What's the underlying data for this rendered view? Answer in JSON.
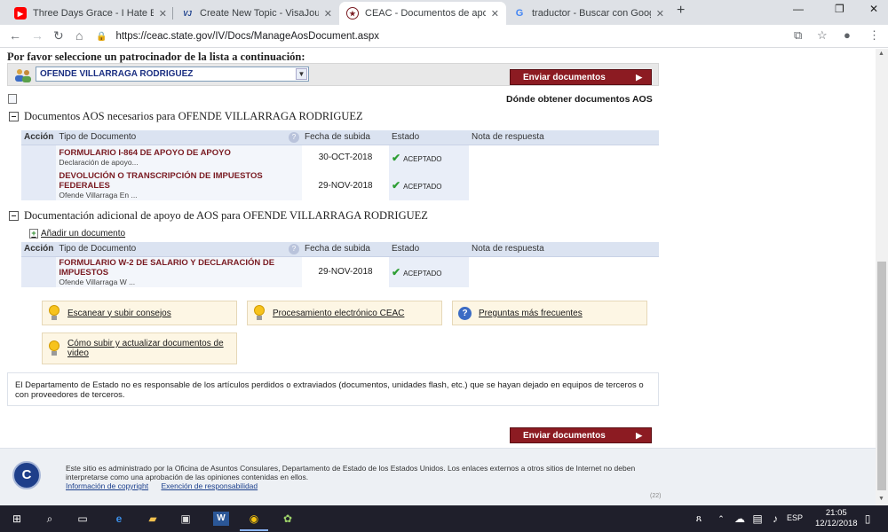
{
  "browser": {
    "tabs": [
      {
        "title": "Three Days Grace - I Hate Everyt",
        "icon": "youtube-icon"
      },
      {
        "title": "Create New Topic - VisaJourney",
        "icon": "visajourney-icon"
      },
      {
        "title": "CEAC - Documentos de apoyo",
        "icon": "state-seal-icon"
      },
      {
        "title": "traductor - Buscar con Google",
        "icon": "google-icon"
      }
    ],
    "url": "https://ceac.state.gov/IV/Docs/ManageAosDocument.aspx"
  },
  "sponsor": {
    "prompt": "Por favor seleccione un patrocinador de la lista a continuación:",
    "selected": "OFENDE VILLARRAGA RODRIGUEZ",
    "send_button": "Enviar documentos"
  },
  "where_link": "Dónde obtener documentos AOS",
  "section1": {
    "title": "Documentos AOS necesarios para OFENDE VILLARRAGA RODRIGUEZ",
    "columns": [
      "Acción",
      "Tipo de Documento",
      "",
      "Fecha de subida",
      "Estado",
      "Nota de respuesta"
    ],
    "rows": [
      {
        "type": "FORMULARIO I-864 DE APOYO DE APOYO",
        "sub": "Declaración de apoyo...",
        "date": "30-OCT-2018",
        "status": "ACEPTADO"
      },
      {
        "type": "DEVOLUCIÓN O TRANSCRIPCIÓN DE IMPUESTOS FEDERALES",
        "sub": "Ofende Villarraga En ...",
        "date": "29-NOV-2018",
        "status": "ACEPTADO"
      }
    ]
  },
  "section2": {
    "title": "Documentación adicional de apoyo de AOS para OFENDE VILLARRAGA RODRIGUEZ",
    "add_link": "Añadir un documento",
    "columns": [
      "Acción",
      "Tipo de Documento",
      "",
      "Fecha de subida",
      "Estado",
      "Nota de respuesta"
    ],
    "rows": [
      {
        "type": "FORMULARIO W-2 DE SALARIO Y DECLARACIÓN DE IMPUESTOS",
        "sub": "Ofende Villarraga W ...",
        "date": "29-NOV-2018",
        "status": "ACEPTADO"
      }
    ]
  },
  "tips": {
    "scan": "Escanear y subir consejos",
    "electronic": "Procesamiento electrónico CEAC",
    "faq": "Preguntas más frecuentes",
    "video": "Cómo subir y actualizar documentos de video"
  },
  "disclaimer": "El Departamento de Estado no es responsable de los artículos perdidos o extraviados (documentos, unidades flash, etc.) que se hayan dejado en equipos de terceros o con proveedores de terceros.",
  "bottom_button": "Enviar documentos",
  "footer": {
    "text": "Este sitio es administrado por la Oficina de Asuntos Consulares, Departamento de Estado de los Estados Unidos. Los enlaces externos a otros sitios de Internet no deben interpretarse como una aprobación de las opiniones contenidas en ellos.",
    "copyright": "Información de copyright",
    "liability": "Exención de responsabilidad",
    "version": "(22)",
    "seal_letter": "C"
  },
  "taskbar": {
    "lang": "ESP",
    "time": "21:05",
    "date": "12/12/2018"
  }
}
